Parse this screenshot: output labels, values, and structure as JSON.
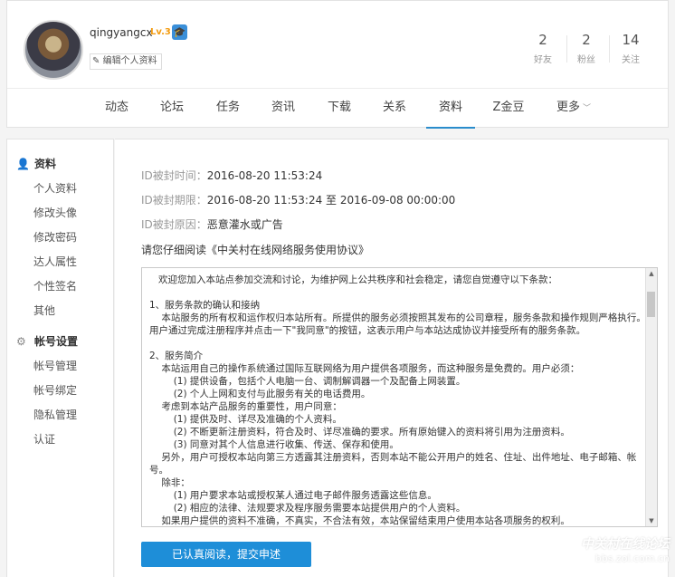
{
  "profile": {
    "username": "qingyangcx",
    "level": "Lv.3",
    "edit_label": "编辑个人资料",
    "stats": [
      {
        "value": "2",
        "label": "好友"
      },
      {
        "value": "2",
        "label": "粉丝"
      },
      {
        "value": "14",
        "label": "关注"
      }
    ]
  },
  "nav": {
    "items": [
      "动态",
      "论坛",
      "任务",
      "资讯",
      "下载",
      "关系",
      "资料",
      "Z金豆",
      "更多"
    ],
    "active": "资料"
  },
  "sidebar": {
    "section1": {
      "title": "资料",
      "items": [
        "个人资料",
        "修改头像",
        "修改密码",
        "达人属性",
        "个性签名",
        "其他"
      ]
    },
    "section2": {
      "title": "帐号设置",
      "items": [
        "帐号管理",
        "帐号绑定",
        "隐私管理",
        "认证"
      ]
    }
  },
  "ban": {
    "time_label": "ID被封时间：",
    "time_value": "2016-08-20 11:53:24",
    "period_label": "ID被封期限：",
    "period_value": "2016-08-20 11:53:24 至 2016-09-08 00:00:00",
    "reason_label": "ID被封原因：",
    "reason_value": "恶意灌水或广告"
  },
  "read_tip": "请您仔细阅读《中关村在线网络服务使用协议》",
  "agreement_text": "   欢迎您加入本站点参加交流和讨论，为维护网上公共秩序和社会稳定，请您自觉遵守以下条款：\n\n1、服务条款的确认和接纳\n    本站服务的所有权和运作权归本站所有。所提供的服务必须按照其发布的公司章程，服务条款和操作规则严格执行。用户通过完成注册程序并点击一下\"我同意\"的按钮，这表示用户与本站达成协议并接受所有的服务条款。\n\n2、服务简介\n    本站运用自己的操作系统通过国际互联网络为用户提供各项服务，而这种服务是免费的。用户必须：\n        (1) 提供设备，包括个人电脑一台、调制解调器一个及配备上网装置。\n        (2) 个人上网和支付与此服务有关的电话费用。\n    考虑到本站产品服务的重要性，用户同意：\n        (1) 提供及时、详尽及准确的个人资料。\n        (2) 不断更新注册资料，符合及时、详尽准确的要求。所有原始键入的资料将引用为注册资料。\n        (3) 同意对其个人信息进行收集、传送、保存和使用。\n    另外，用户可授权本站向第三方透露其注册资料，否则本站不能公开用户的姓名、住址、出件地址、电子邮箱、帐号。\n    除非：\n        (1) 用户要求本站或授权某人通过电子邮件服务透露这些信息。\n        (2) 相应的法律、法规要求及程序服务需要本站提供用户的个人资料。\n    如果用户提供的资料不准确，不真实，不合法有效，本站保留结束用户使用本站各项服务的权利。",
  "submit_label": "已认真阅读，提交申述",
  "watermark": {
    "line1": "中关村在线论坛",
    "line2": "bbs.zol.com.cn"
  },
  "colors": {
    "accent": "#1e8ed8",
    "level": "#f39c12"
  }
}
